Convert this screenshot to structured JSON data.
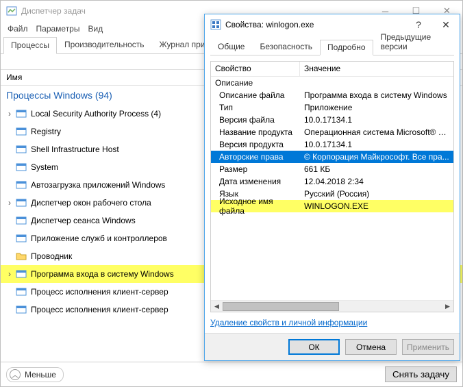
{
  "task_manager": {
    "title": "Диспетчер задач",
    "menu": {
      "file": "Файл",
      "options": "Параметры",
      "view": "Вид"
    },
    "tabs": {
      "processes": "Процессы",
      "performance": "Производительность",
      "app_history": "Журнал прило"
    },
    "columns": {
      "name": "Имя"
    },
    "group_header": "Процессы Windows (94)",
    "processes": [
      {
        "name": "Local Security Authority Process (4)",
        "expandable": true
      },
      {
        "name": "Registry",
        "expandable": false
      },
      {
        "name": "Shell Infrastructure Host",
        "expandable": false
      },
      {
        "name": "System",
        "expandable": false
      },
      {
        "name": "Автозагрузка приложений Windows",
        "expandable": false
      },
      {
        "name": "Диспетчер окон рабочего стола",
        "expandable": true
      },
      {
        "name": "Диспетчер сеанса  Windows",
        "expandable": false
      },
      {
        "name": "Приложение служб и контроллеров",
        "expandable": false
      },
      {
        "name": "Проводник",
        "expandable": false,
        "icon": "folder"
      },
      {
        "name": "Программа входа в систему Windows",
        "expandable": true,
        "highlight": true
      },
      {
        "name": "Процесс исполнения клиент-сервер",
        "expandable": false
      },
      {
        "name": "Процесс исполнения клиент-сервер",
        "expandable": false
      }
    ],
    "footer": {
      "less": "Меньше",
      "end_task": "Снять задачу"
    }
  },
  "properties": {
    "title": "Свойства: winlogon.exe",
    "tabs": {
      "general": "Общие",
      "security": "Безопасность",
      "details": "Подробно",
      "previous": "Предыдущие версии"
    },
    "columns": {
      "property": "Свойство",
      "value": "Значение"
    },
    "rows": [
      {
        "k": "Описание",
        "v": "",
        "indent": false
      },
      {
        "k": "Описание файла",
        "v": "Программа входа в систему Windows",
        "indent": true
      },
      {
        "k": "Тип",
        "v": "Приложение",
        "indent": true
      },
      {
        "k": "Версия файла",
        "v": "10.0.17134.1",
        "indent": true
      },
      {
        "k": "Название продукта",
        "v": "Операционная система Microsoft® W...",
        "indent": true
      },
      {
        "k": "Версия продукта",
        "v": "10.0.17134.1",
        "indent": true
      },
      {
        "k": "Авторские права",
        "v": "© Корпорация Майкрософт. Все пра...",
        "indent": true,
        "selected": true
      },
      {
        "k": "Размер",
        "v": "661 КБ",
        "indent": true
      },
      {
        "k": "Дата изменения",
        "v": "12.04.2018 2:34",
        "indent": true
      },
      {
        "k": "Язык",
        "v": "Русский (Россия)",
        "indent": true
      },
      {
        "k": "Исходное имя файла",
        "v": "WINLOGON.EXE",
        "indent": true,
        "highlight": true
      }
    ],
    "remove_link": "Удаление свойств и личной информации",
    "buttons": {
      "ok": "ОК",
      "cancel": "Отмена",
      "apply": "Применить"
    }
  }
}
